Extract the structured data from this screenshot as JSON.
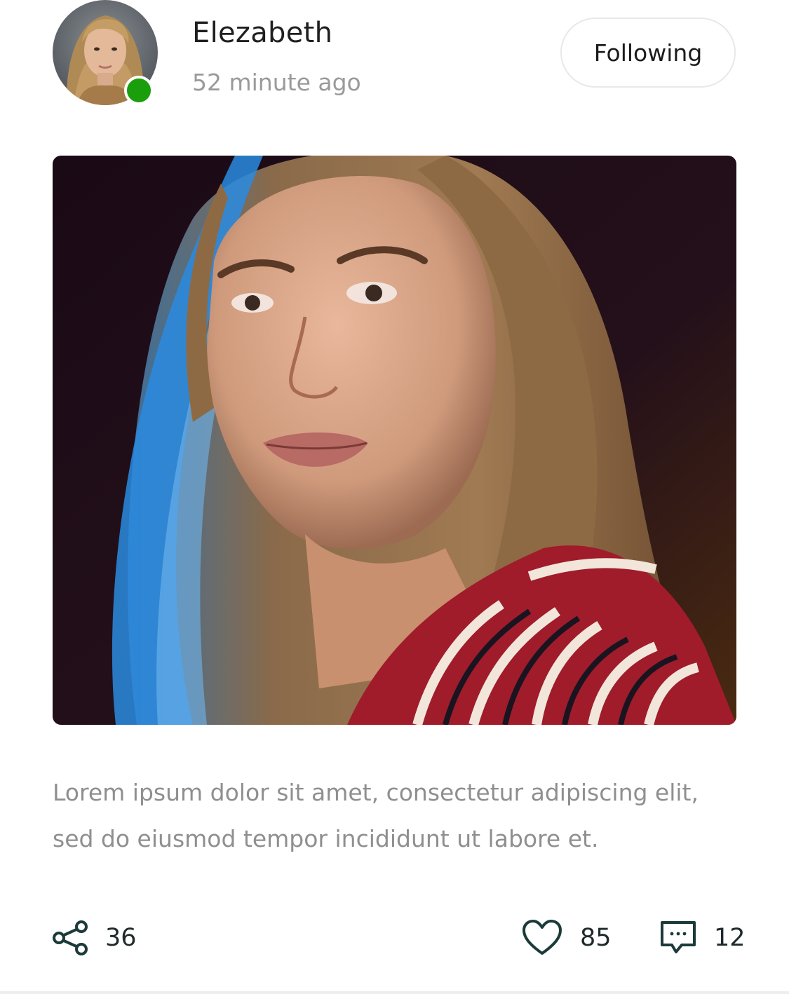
{
  "post": {
    "author": {
      "name": "Elezabeth",
      "online": true,
      "online_color": "#1a9e0c"
    },
    "time": "52 minute ago",
    "follow_label": "Following",
    "caption": "Lorem ipsum dolor sit amet, consectetur adipiscing elit, sed do eiusmod tempor incididunt ut labore et.",
    "actions": {
      "shares": {
        "icon": "share-icon",
        "count": "36"
      },
      "likes": {
        "icon": "heart-icon",
        "count": "85"
      },
      "comments": {
        "icon": "comment-icon",
        "count": "12"
      }
    },
    "icon_color": "#1c3a3a"
  }
}
